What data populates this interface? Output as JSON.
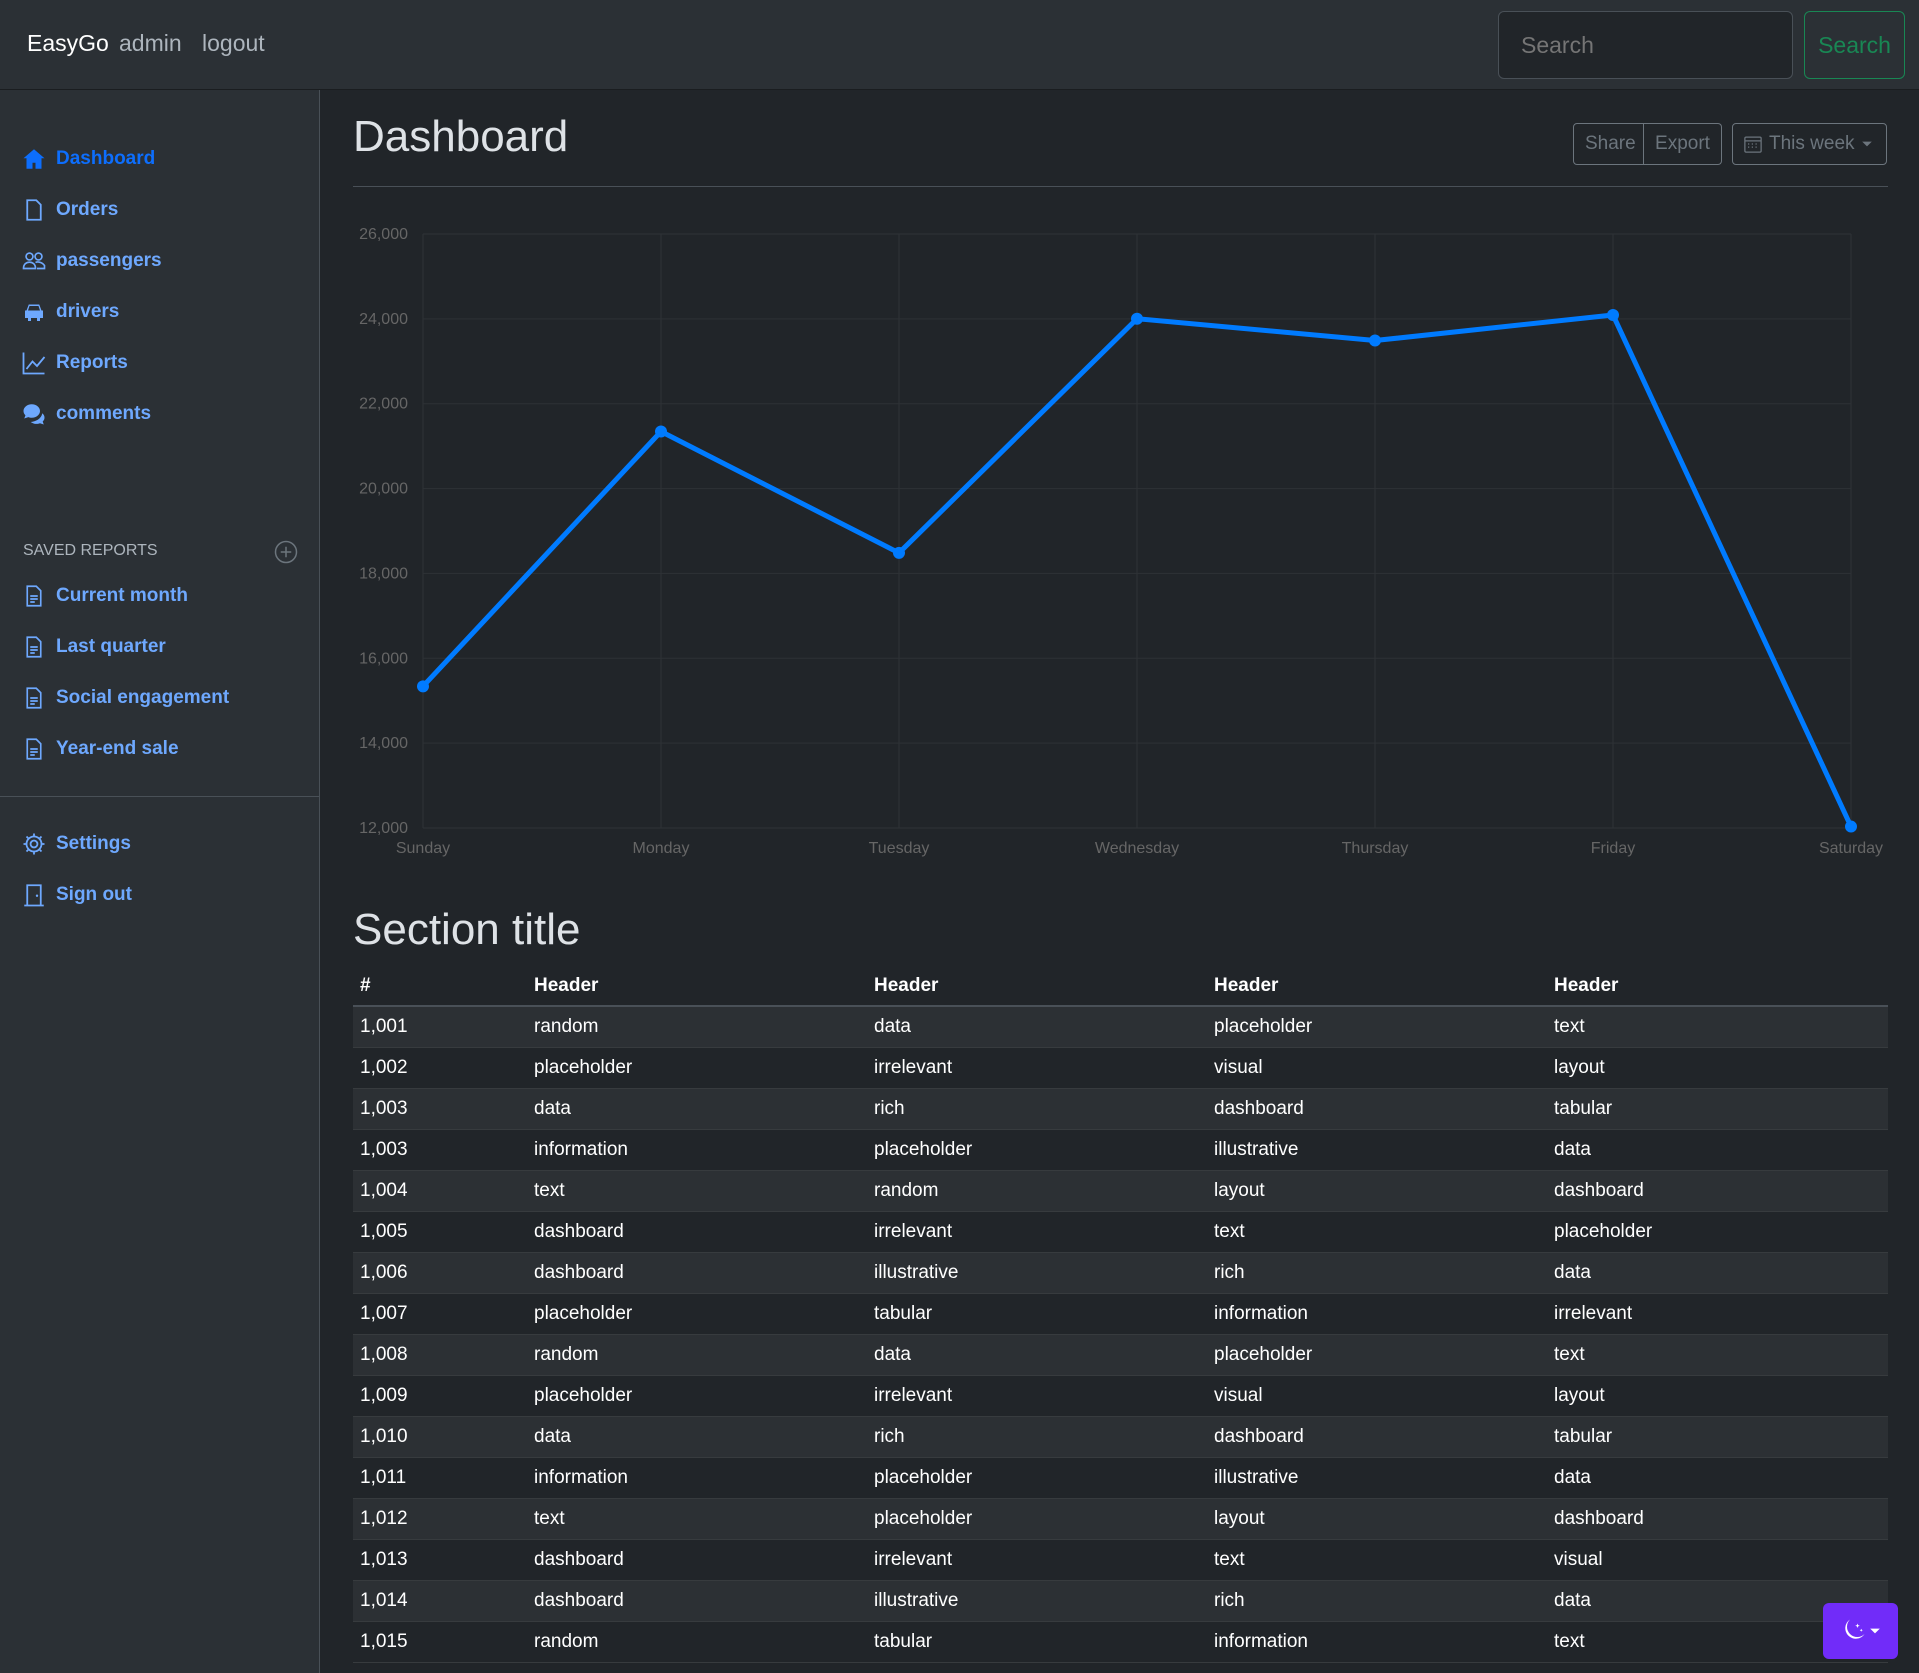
{
  "navbar": {
    "brand": "EasyGo",
    "links": [
      "admin",
      "logout"
    ],
    "search_placeholder": "Search",
    "search_button": "Search"
  },
  "sidebar": {
    "items": [
      {
        "label": "Dashboard",
        "icon": "house-icon",
        "active": true
      },
      {
        "label": "Orders",
        "icon": "file-icon"
      },
      {
        "label": "passengers",
        "icon": "people-icon"
      },
      {
        "label": "drivers",
        "icon": "car-icon"
      },
      {
        "label": "Reports",
        "icon": "graph-icon"
      },
      {
        "label": "comments",
        "icon": "chat-icon"
      }
    ],
    "saved_heading": "Saved reports",
    "saved": [
      {
        "label": "Current month",
        "icon": "document-icon"
      },
      {
        "label": "Last quarter",
        "icon": "document-icon"
      },
      {
        "label": "Social engagement",
        "icon": "document-icon"
      },
      {
        "label": "Year-end sale",
        "icon": "document-icon"
      }
    ],
    "bottom": [
      {
        "label": "Settings",
        "icon": "gear-icon"
      },
      {
        "label": "Sign out",
        "icon": "door-icon"
      }
    ]
  },
  "header": {
    "title": "Dashboard",
    "share": "Share",
    "export": "Export",
    "period": "This week"
  },
  "colors": {
    "accent": "#0d6efd",
    "link": "#6ea8fe",
    "success": "#198754",
    "toggle": "#712cf9"
  },
  "chart_data": {
    "type": "line",
    "categories": [
      "Sunday",
      "Monday",
      "Tuesday",
      "Wednesday",
      "Thursday",
      "Friday",
      "Saturday"
    ],
    "values": [
      15339,
      21345,
      18483,
      24003,
      23489,
      24092,
      12034
    ],
    "y_ticks": [
      "12,000",
      "14,000",
      "16,000",
      "18,000",
      "20,000",
      "22,000",
      "24,000",
      "26,000"
    ],
    "ylim": [
      12000,
      26000
    ],
    "grid": true,
    "color": "#007bff"
  },
  "section": {
    "title": "Section title",
    "columns": [
      "#",
      "Header",
      "Header",
      "Header",
      "Header"
    ],
    "rows": [
      [
        "1,001",
        "random",
        "data",
        "placeholder",
        "text"
      ],
      [
        "1,002",
        "placeholder",
        "irrelevant",
        "visual",
        "layout"
      ],
      [
        "1,003",
        "data",
        "rich",
        "dashboard",
        "tabular"
      ],
      [
        "1,003",
        "information",
        "placeholder",
        "illustrative",
        "data"
      ],
      [
        "1,004",
        "text",
        "random",
        "layout",
        "dashboard"
      ],
      [
        "1,005",
        "dashboard",
        "irrelevant",
        "text",
        "placeholder"
      ],
      [
        "1,006",
        "dashboard",
        "illustrative",
        "rich",
        "data"
      ],
      [
        "1,007",
        "placeholder",
        "tabular",
        "information",
        "irrelevant"
      ],
      [
        "1,008",
        "random",
        "data",
        "placeholder",
        "text"
      ],
      [
        "1,009",
        "placeholder",
        "irrelevant",
        "visual",
        "layout"
      ],
      [
        "1,010",
        "data",
        "rich",
        "dashboard",
        "tabular"
      ],
      [
        "1,011",
        "information",
        "placeholder",
        "illustrative",
        "data"
      ],
      [
        "1,012",
        "text",
        "placeholder",
        "layout",
        "dashboard"
      ],
      [
        "1,013",
        "dashboard",
        "irrelevant",
        "text",
        "visual"
      ],
      [
        "1,014",
        "dashboard",
        "illustrative",
        "rich",
        "data"
      ],
      [
        "1,015",
        "random",
        "tabular",
        "information",
        "text"
      ]
    ]
  },
  "theme_toggle": {
    "icon": "moon-stars-icon"
  }
}
